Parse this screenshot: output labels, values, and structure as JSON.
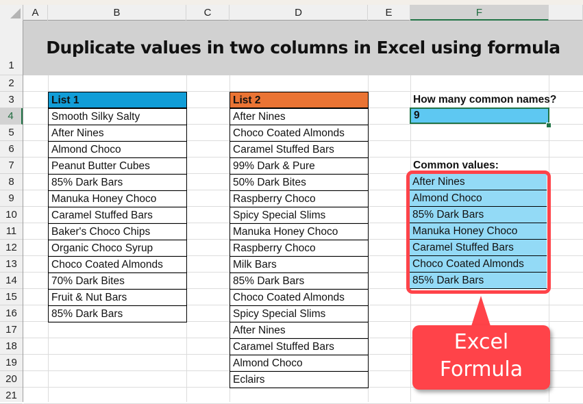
{
  "app": "Microsoft Excel",
  "columns": [
    "A",
    "B",
    "C",
    "D",
    "E",
    "F"
  ],
  "selected_column": "F",
  "rows": [
    "1",
    "2",
    "3",
    "4",
    "5",
    "6",
    "7",
    "8",
    "9",
    "10",
    "11",
    "12",
    "13",
    "14",
    "15",
    "16",
    "17",
    "18",
    "19",
    "20",
    "21"
  ],
  "selected_row": "4",
  "title": "Duplicate values in two columns in Excel using formula",
  "list1": {
    "header": "List 1",
    "items": [
      "Smooth Silky Salty",
      "After Nines",
      "Almond Choco",
      "Peanut Butter Cubes",
      "85% Dark Bars",
      "Manuka Honey Choco",
      "Caramel Stuffed Bars",
      "Baker's Choco Chips",
      "Organic Choco Syrup",
      "Choco Coated Almonds",
      "70% Dark Bites",
      "Fruit & Nut Bars",
      "85% Dark Bars"
    ]
  },
  "list2": {
    "header": "List 2",
    "items": [
      "After Nines",
      "Choco Coated Almonds",
      "Caramel Stuffed Bars",
      "99% Dark & Pure",
      "50% Dark Bites",
      "Raspberry Choco",
      "Spicy Special Slims",
      "Manuka Honey Choco",
      "Raspberry Choco",
      "Milk Bars",
      "85% Dark Bars",
      "Choco Coated Almonds",
      "Spicy Special Slims",
      "After Nines",
      "Caramel Stuffed Bars",
      "Almond Choco",
      "Eclairs"
    ]
  },
  "summary": {
    "count_label": "How many common names?",
    "count_value": "9",
    "common_label": "Common values:",
    "common_values": [
      "After Nines",
      "Almond Choco",
      "85% Dark Bars",
      "Manuka Honey Choco",
      "Caramel Stuffed Bars",
      "Choco Coated Almonds",
      "85% Dark Bars"
    ]
  },
  "callout": {
    "line1": "Excel",
    "line2": "Formula"
  },
  "colors": {
    "list1_header": "#119dd7",
    "list2_header": "#ea7434",
    "count_fill": "#5ec8f2",
    "result_fill": "#93daf6",
    "highlight": "#ff4349",
    "selection": "#217346",
    "title_band": "#d1d1d1"
  }
}
